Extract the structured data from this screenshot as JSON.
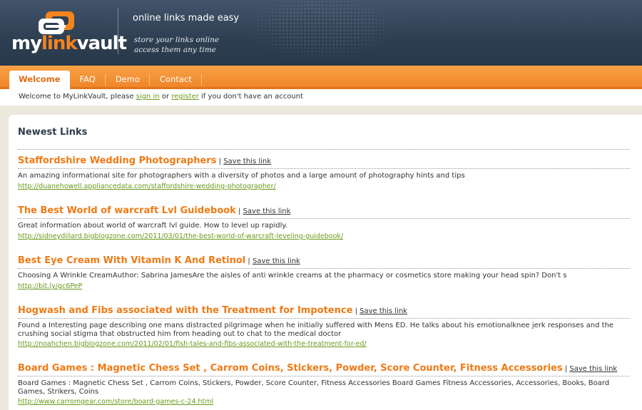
{
  "header": {
    "logo_prefix": "my",
    "logo_accent": "link",
    "logo_suffix": "vault",
    "tagline": "online links made easy",
    "tagline_sub_1": "store your links online",
    "tagline_sub_2": "access them any time"
  },
  "nav": {
    "tabs": [
      {
        "label": "Welcome",
        "active": true
      },
      {
        "label": "FAQ",
        "active": false
      },
      {
        "label": "Demo",
        "active": false
      },
      {
        "label": "Contact",
        "active": false
      }
    ]
  },
  "welcome": {
    "before": "Welcome to MyLinkVault, please ",
    "sign_in": "sign in",
    "middle": " or ",
    "register": "register",
    "after": " if you don't have an account"
  },
  "main": {
    "title": "Newest Links",
    "save_label": "Save this link",
    "links": [
      {
        "title": "Staffordshire Wedding Photographers",
        "description": "An amazing informational site for photographers with a diversity of photos and a large amount of photography hints and tips",
        "url": "http://duanehowell.appliancedata.com/staffordshire-wedding-photographer/"
      },
      {
        "title": "The Best World of warcraft Lvl Guidebook",
        "description": "Great information about world of warcraft lvl guide. How to level up rapidly.",
        "url": "http://sidneydillard.bigblogzone.com/2011/03/01/the-best-world-of-warcraft-leveling-guidebook/"
      },
      {
        "title": "Best Eye Cream With Vitamin K And Retinol",
        "description": "Choosing A Wrinkle CreamAuthor: Sabrina JamesAre the aisles of anti wrinkle creams at the pharmacy or cosmetics store making your head spin? Don't s",
        "url": "http://bit.ly/gc6PeP"
      },
      {
        "title": "Hogwash and Fibs associated with the Treatment for Impotence",
        "description": "Found a Interesting page describing one mans distracted pilgrimage when he initially suffered with Mens ED. He talks about his emotionalknee jerk responses and the crushing social stigma that obstructed him from heading out to chat to the medical doctor",
        "url": "http://noahchen.bigblogzone.com/2011/02/01/fish-tales-and-fibs-associated-with-the-treatment-for-ed/"
      },
      {
        "title": "Board Games : Magnetic Chess Set , Carrom Coins, Stickers, Powder, Score Counter, Fitness Accessories",
        "description": "Board Games : Magnetic Chess Set , Carrom Coins, Stickers, Powder, Score Counter, Fitness Accessories Board Games Fitness Accessories, Accessories, Books, Board Games, Strikers, Coins",
        "url": "http://www.carromgear.com/store/board-games-c-24.html"
      }
    ]
  },
  "colors": {
    "header_bg": "#2e3f52",
    "nav_orange": "#f0862a",
    "link_title": "#f07a14",
    "link_url": "#6a9a1c"
  }
}
